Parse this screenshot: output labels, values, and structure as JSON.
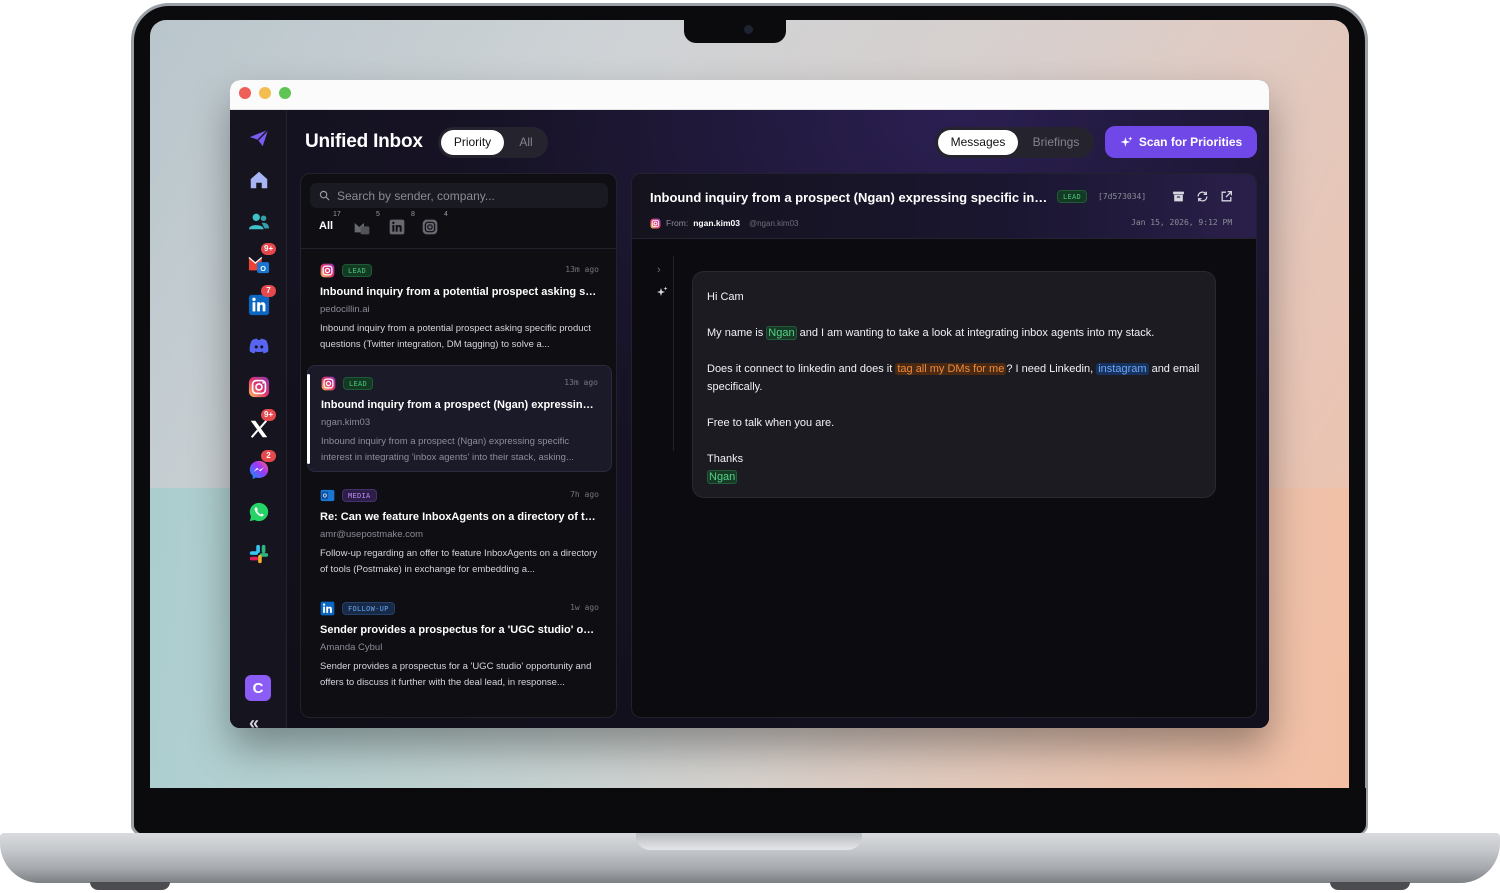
{
  "app": {
    "title": "Unified Inbox",
    "view_toggle": {
      "active": "Priority",
      "inactive": "All"
    },
    "detail_toggle": {
      "active": "Messages",
      "inactive": "Briefings"
    },
    "scan_button": "Scan for Priorities"
  },
  "sidebar": {
    "items": [
      {
        "name": "home-icon"
      },
      {
        "name": "contacts-icon"
      },
      {
        "name": "gmail-outlook-icon",
        "badge": "9+"
      },
      {
        "name": "linkedin-icon",
        "badge": "7"
      },
      {
        "name": "discord-icon"
      },
      {
        "name": "instagram-icon"
      },
      {
        "name": "x-icon",
        "badge": "9+"
      },
      {
        "name": "messenger-icon",
        "badge": "2"
      },
      {
        "name": "whatsapp-icon"
      },
      {
        "name": "slack-icon"
      }
    ],
    "user_initial": "C",
    "collapse_label": "«"
  },
  "list": {
    "search_placeholder": "Search by sender, company...",
    "filters": [
      {
        "label": "All",
        "count": "17"
      },
      {
        "icon": "gmail-outlook-icon",
        "count": "5"
      },
      {
        "icon": "linkedin-icon",
        "count": "8"
      },
      {
        "icon": "instagram-icon",
        "count": "4"
      }
    ],
    "messages": [
      {
        "channel": "instagram",
        "tag": "LEAD",
        "time": "13m ago",
        "subject": "Inbound inquiry from a potential prospect asking specific product questions",
        "sender": "pedocillin.ai",
        "preview": "Inbound inquiry from a potential prospect asking specific product questions (Twitter integration, DM tagging) to solve a..."
      },
      {
        "channel": "instagram",
        "tag": "LEAD",
        "time": "13m ago",
        "subject": "Inbound inquiry from a prospect (Ngan) expressing specific interest",
        "sender": "ngan.kim03",
        "preview": "Inbound inquiry from a prospect (Ngan) expressing specific interest in integrating 'inbox agents' into their stack, asking..."
      },
      {
        "channel": "outlook",
        "tag": "MEDIA",
        "time": "7h ago",
        "subject": "Re: Can we feature InboxAgents on a directory of tools?",
        "sender": "amr@usepostmake.com",
        "preview": "Follow-up regarding an offer to feature InboxAgents on a directory of tools (Postmake) in exchange for embedding a..."
      },
      {
        "channel": "linkedin",
        "tag": "FOLLOW-UP",
        "time": "1w ago",
        "subject": "Sender provides a prospectus for a 'UGC studio' opportunity",
        "sender": "Amanda Cybul",
        "preview": "Sender provides a prospectus for a 'UGC studio' opportunity and offers to discuss it further with the deal lead, in response..."
      }
    ]
  },
  "detail": {
    "subject": "Inbound inquiry from a prospect (Ngan) expressing specific interest",
    "tag": "LEAD",
    "id": "[7d573034]",
    "from_label": "From:",
    "from_name": "ngan.kim03",
    "from_handle": "@ngan.kim03",
    "date": "Jan 15, 2026, 9:12 PM",
    "body": {
      "greeting": "Hi Cam",
      "p1_a": "My name is ",
      "p1_name": "Ngan",
      "p1_b": " and I am wanting to take a look at integrating inbox agents into my stack.",
      "p2_a": "Does it connect to linkedin and does it ",
      "p2_hl": "tag all my DMs for me",
      "p2_b": "? I need Linkedin, ",
      "p2_ig": "instagram",
      "p2_c": " and email specifically.",
      "p3": "Free to talk when you are.",
      "thanks": "Thanks",
      "signature": "Ngan"
    }
  },
  "colors": {
    "accent": "#7048e8",
    "lead": "#4cc47a",
    "media": "#b58cf3",
    "followup": "#6aa4f0",
    "badge": "#e5484d"
  }
}
